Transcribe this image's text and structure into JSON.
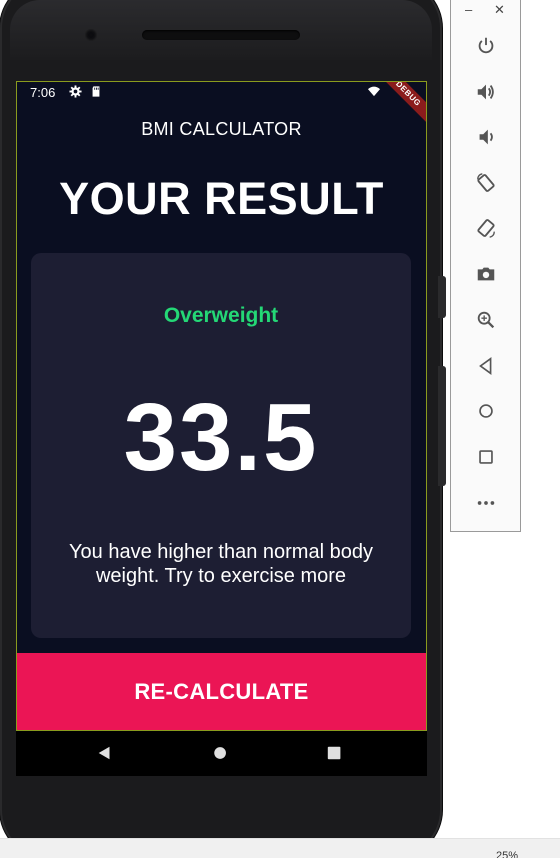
{
  "status_bar": {
    "time": "7:06",
    "debug_label": "DEBUG",
    "icons": [
      "settings-icon",
      "sd-card-icon",
      "wifi-icon",
      "battery-icon"
    ]
  },
  "app_bar": {
    "title": "BMI CALCULATOR"
  },
  "result": {
    "heading": "YOUR RESULT",
    "status": "Overweight",
    "status_color": "#24d876",
    "bmi_value": "33.5",
    "advice": "You have higher than normal body weight. Try to exercise more"
  },
  "recalculate_button": {
    "label": "RE-CALCULATE",
    "color": "#eb1555"
  },
  "colors": {
    "background": "#0a0e21",
    "card": "#1d1e33"
  },
  "navigation": [
    "back-icon",
    "home-icon",
    "recents-icon"
  ],
  "emulator_toolbar": {
    "window_controls": [
      "minimize-icon",
      "close-icon"
    ],
    "buttons": [
      "power-icon",
      "volume-up-icon",
      "volume-down-icon",
      "rotate-left-icon",
      "rotate-right-icon",
      "camera-icon",
      "zoom-icon",
      "back-icon",
      "home-icon",
      "overview-icon",
      "more-icon"
    ]
  },
  "zoom_readout": "25%"
}
